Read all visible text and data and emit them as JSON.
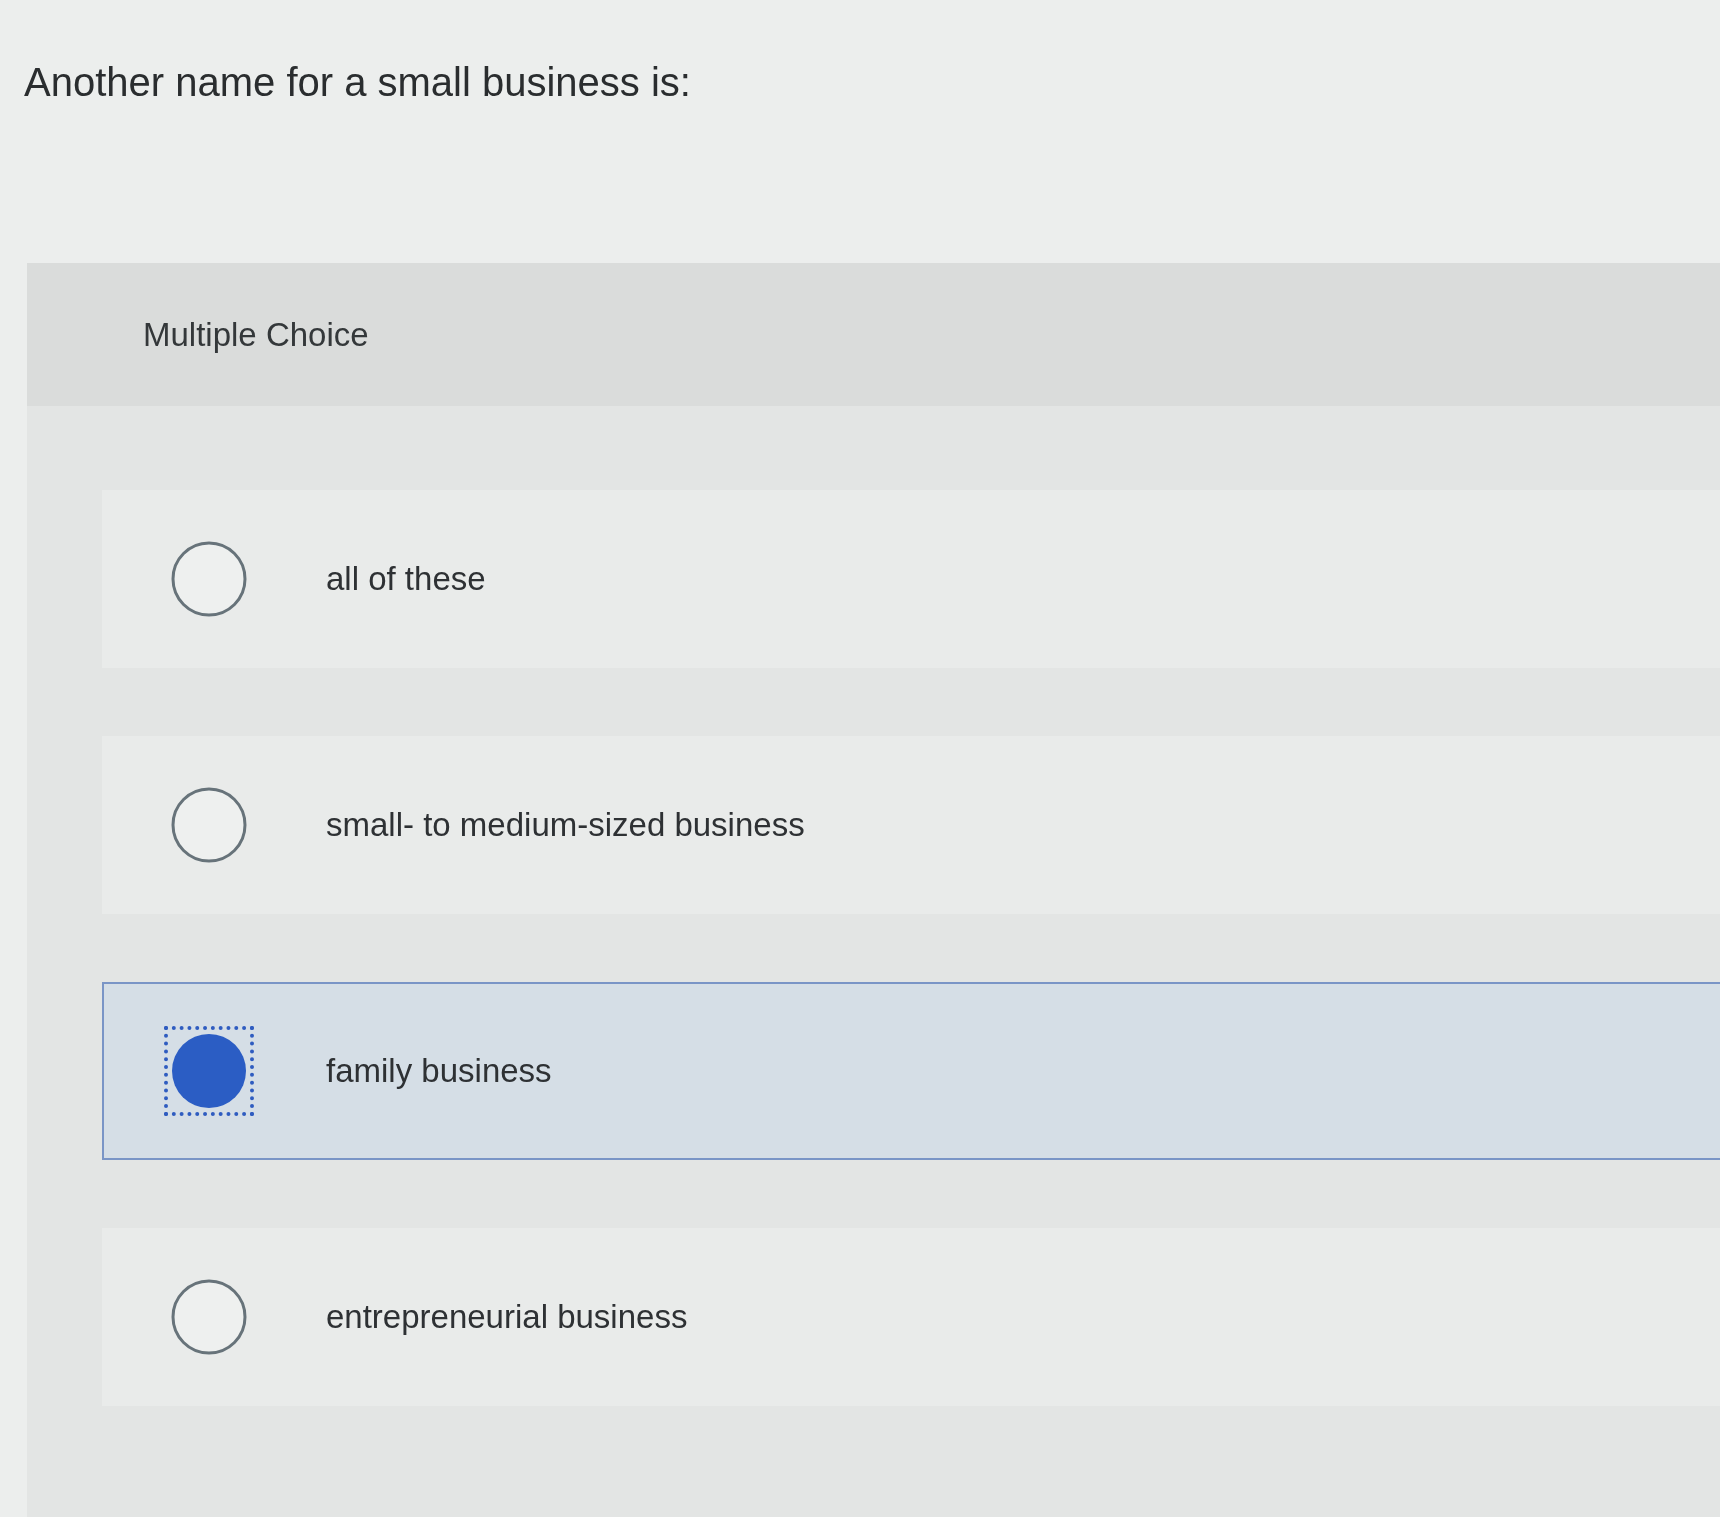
{
  "question": "Another name for a small business is:",
  "panel": {
    "title": "Multiple Choice",
    "options": [
      {
        "label": "all of these",
        "selected": false,
        "focused": false
      },
      {
        "label": "small- to medium-sized business",
        "selected": false,
        "focused": false
      },
      {
        "label": "family business",
        "selected": true,
        "focused": true
      },
      {
        "label": "entrepreneurial business",
        "selected": false,
        "focused": false
      }
    ]
  }
}
